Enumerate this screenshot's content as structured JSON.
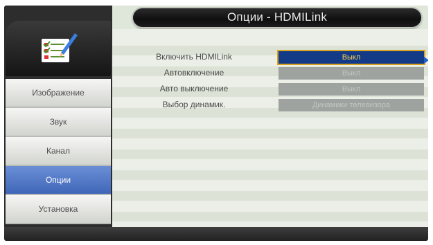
{
  "header": {
    "title": "Опции - HDMILink"
  },
  "sidebar": {
    "items": [
      {
        "label": "Изображение",
        "active": false
      },
      {
        "label": "Звук",
        "active": false
      },
      {
        "label": "Канал",
        "active": false
      },
      {
        "label": "Опции",
        "active": true
      },
      {
        "label": "Установка",
        "active": false
      }
    ]
  },
  "settings": {
    "rows": [
      {
        "label": "Включить HDMILink",
        "value": "Выкл",
        "selected": true,
        "enabled": true
      },
      {
        "label": "Автовключение",
        "value": "Выкл",
        "selected": false,
        "enabled": false
      },
      {
        "label": "Авто выключение",
        "value": "Выкл",
        "selected": false,
        "enabled": false
      },
      {
        "label": "Выбор динамик.",
        "value": "Динамики телевизора",
        "selected": false,
        "enabled": false
      }
    ]
  },
  "colors": {
    "accent": "#3f66b8",
    "selection": "#123a86",
    "selection_text": "#ffd34a"
  },
  "icons": {
    "menu_icon": "checklist-pencil-icon",
    "next_arrow": "arrow-right-icon"
  }
}
